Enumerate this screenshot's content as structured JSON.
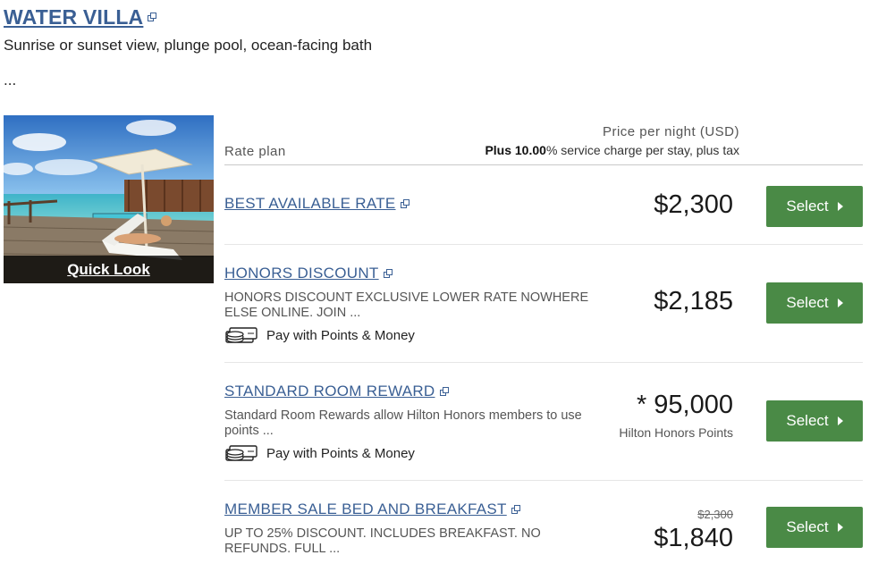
{
  "room": {
    "title": "WATER VILLA",
    "description": "Sunrise or sunset view, plunge pool, ocean-facing bath",
    "more": "...",
    "quick_look": "Quick Look"
  },
  "header": {
    "rate_plan": "Rate plan",
    "price_per_night": "Price per night (USD)",
    "service_prefix": "Plus 10.00",
    "service_suffix": "% service charge per stay, plus tax"
  },
  "rates": [
    {
      "name": "BEST AVAILABLE RATE",
      "price": "$2,300",
      "select_label": "Select"
    },
    {
      "name": "HONORS DISCOUNT",
      "description": "HONORS DISCOUNT EXCLUSIVE LOWER RATE NOWHERE ELSE ONLINE. JOIN ...",
      "pay_points": "Pay with Points & Money",
      "price": "$2,185",
      "select_label": "Select"
    },
    {
      "name": "STANDARD ROOM REWARD",
      "description": "Standard Room Rewards allow Hilton Honors members to use points ...",
      "pay_points": "Pay with Points & Money",
      "price": "* 95,000",
      "price_sub": "Hilton Honors Points",
      "select_label": "Select"
    },
    {
      "name": "MEMBER SALE BED AND BREAKFAST",
      "description": "UP TO 25% DISCOUNT. INCLUDES BREAKFAST. NO REFUNDS. FULL ...",
      "original_price": "$2,300",
      "price": "$1,840",
      "select_label": "Select"
    }
  ],
  "colors": {
    "link": "#3a5f94",
    "select_button": "#4a8a46"
  }
}
